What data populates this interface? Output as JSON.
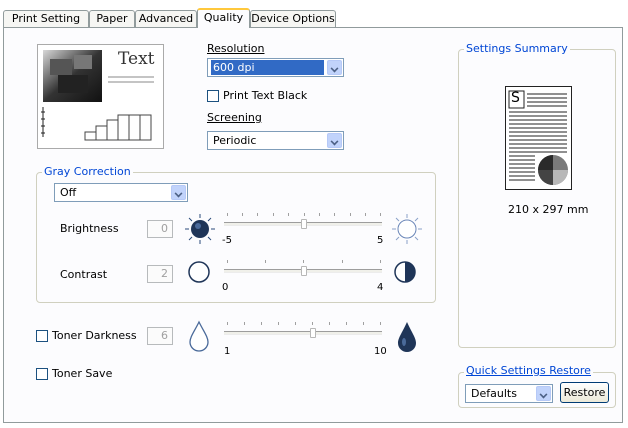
{
  "tabs": [
    {
      "label": "Print Setting"
    },
    {
      "label": "Paper"
    },
    {
      "label": "Advanced"
    },
    {
      "label": "Quality"
    },
    {
      "label": "Device Options"
    }
  ],
  "active_tab": "Quality",
  "preview": {
    "text": "Text"
  },
  "resolution": {
    "label": "Resolution",
    "value": "600 dpi"
  },
  "print_text_black": {
    "label": "Print Text Black",
    "checked": false
  },
  "screening": {
    "label": "Screening",
    "value": "Periodic"
  },
  "gray_correction": {
    "title": "Gray Correction",
    "mode": "Off",
    "brightness": {
      "label": "Brightness",
      "value": "0",
      "min": "-5",
      "max": "5"
    },
    "contrast": {
      "label": "Contrast",
      "value": "2",
      "min": "0",
      "max": "4"
    }
  },
  "toner_darkness": {
    "label": "Toner Darkness",
    "checked": false,
    "value": "6",
    "min": "1",
    "max": "10"
  },
  "toner_save": {
    "label": "Toner Save",
    "checked": false
  },
  "settings_summary": {
    "title": "Settings Summary",
    "letter": "S",
    "paper_size": "210 x 297 mm"
  },
  "quick_settings": {
    "title": "Quick Settings Restore",
    "value": "Defaults",
    "restore_label": "Restore"
  }
}
